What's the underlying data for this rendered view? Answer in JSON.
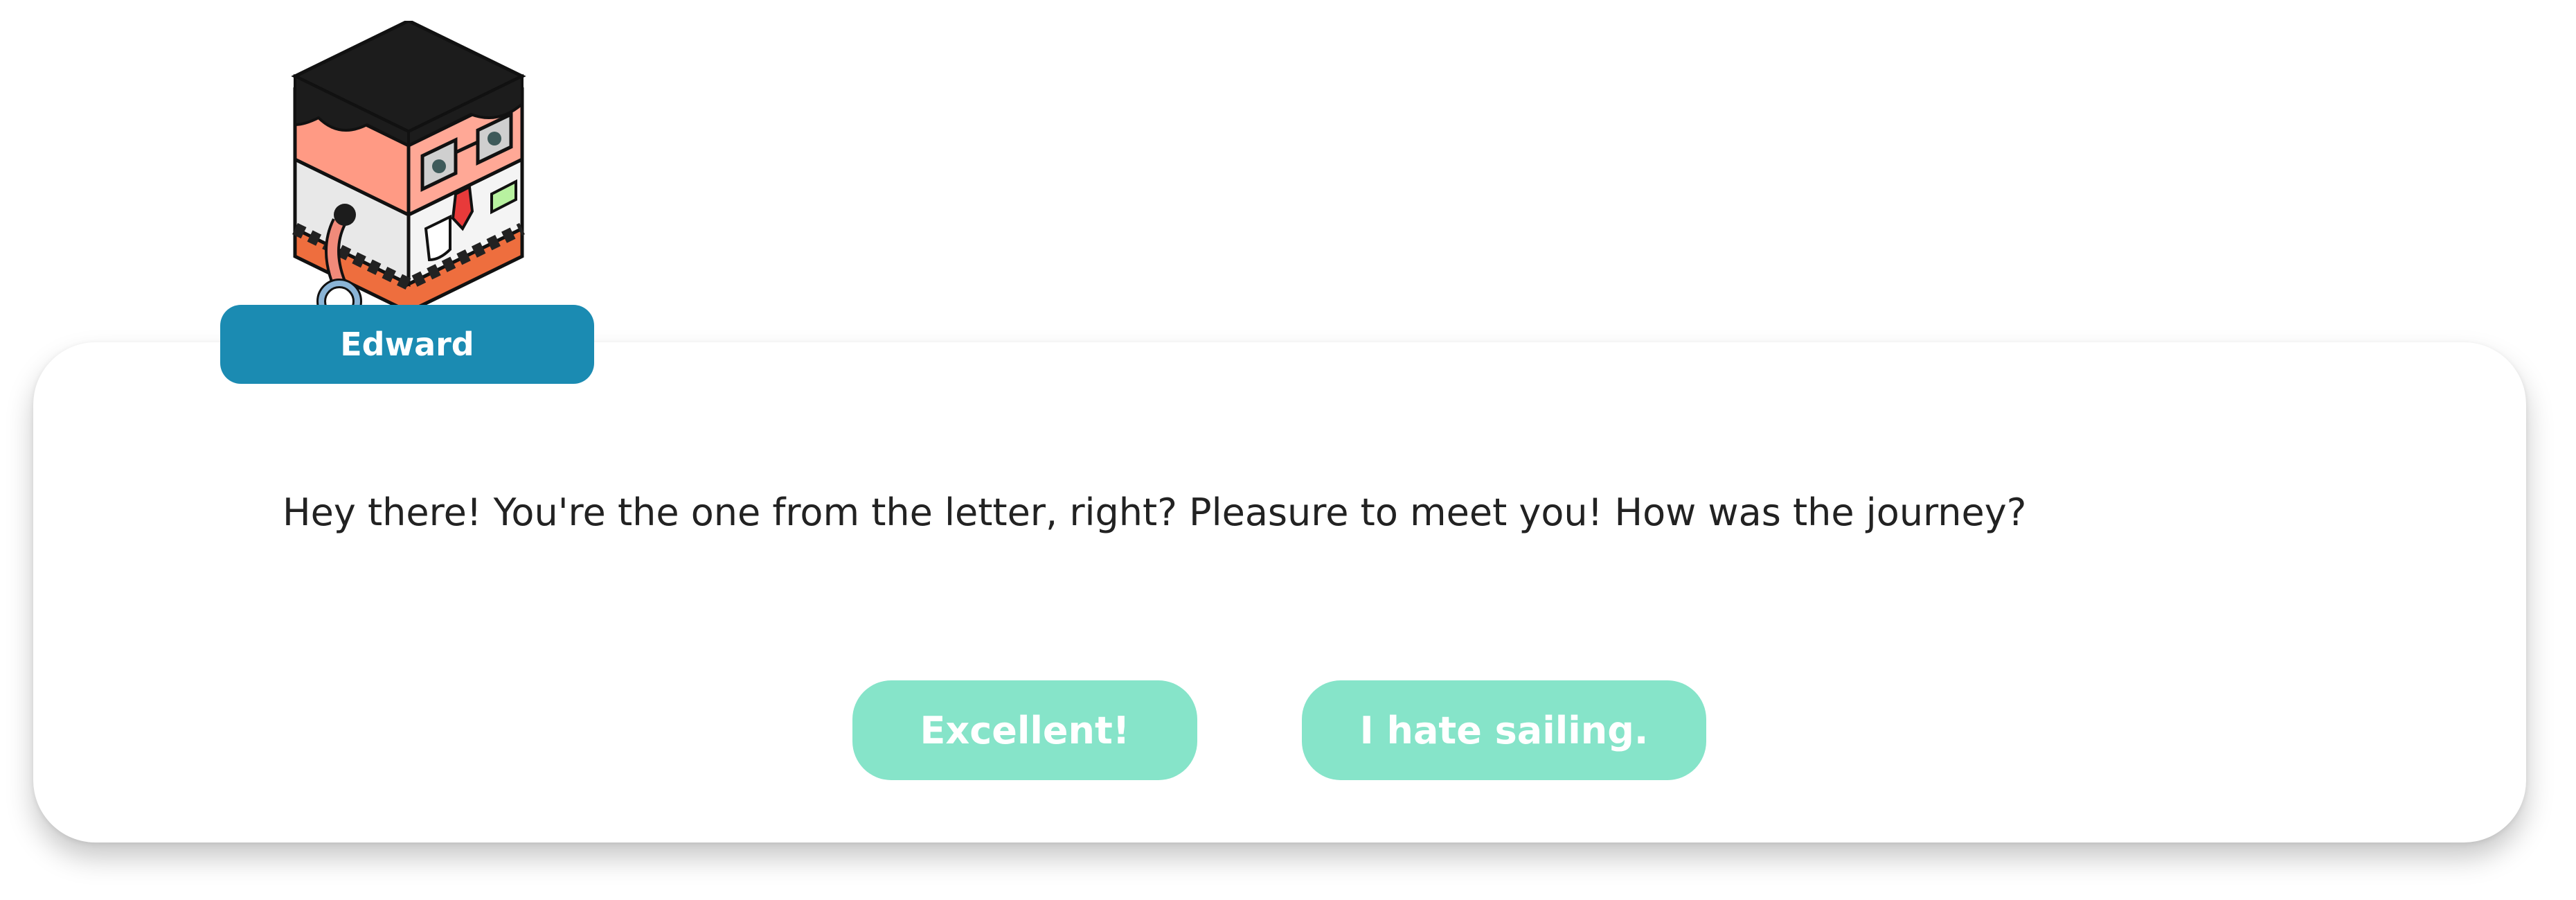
{
  "speaker": {
    "name": "Edward",
    "portrait_icon": "edward-portrait-icon"
  },
  "dialog": {
    "text": "Hey there! You're the one from the letter, right? Pleasure to meet you! How was the journey?"
  },
  "choices": [
    {
      "label": "Excellent!"
    },
    {
      "label": "I hate sailing."
    }
  ],
  "colors": {
    "name_tag": "#1b8bb2",
    "choice_button": "#86e4c9",
    "dialog_text": "#222222"
  }
}
